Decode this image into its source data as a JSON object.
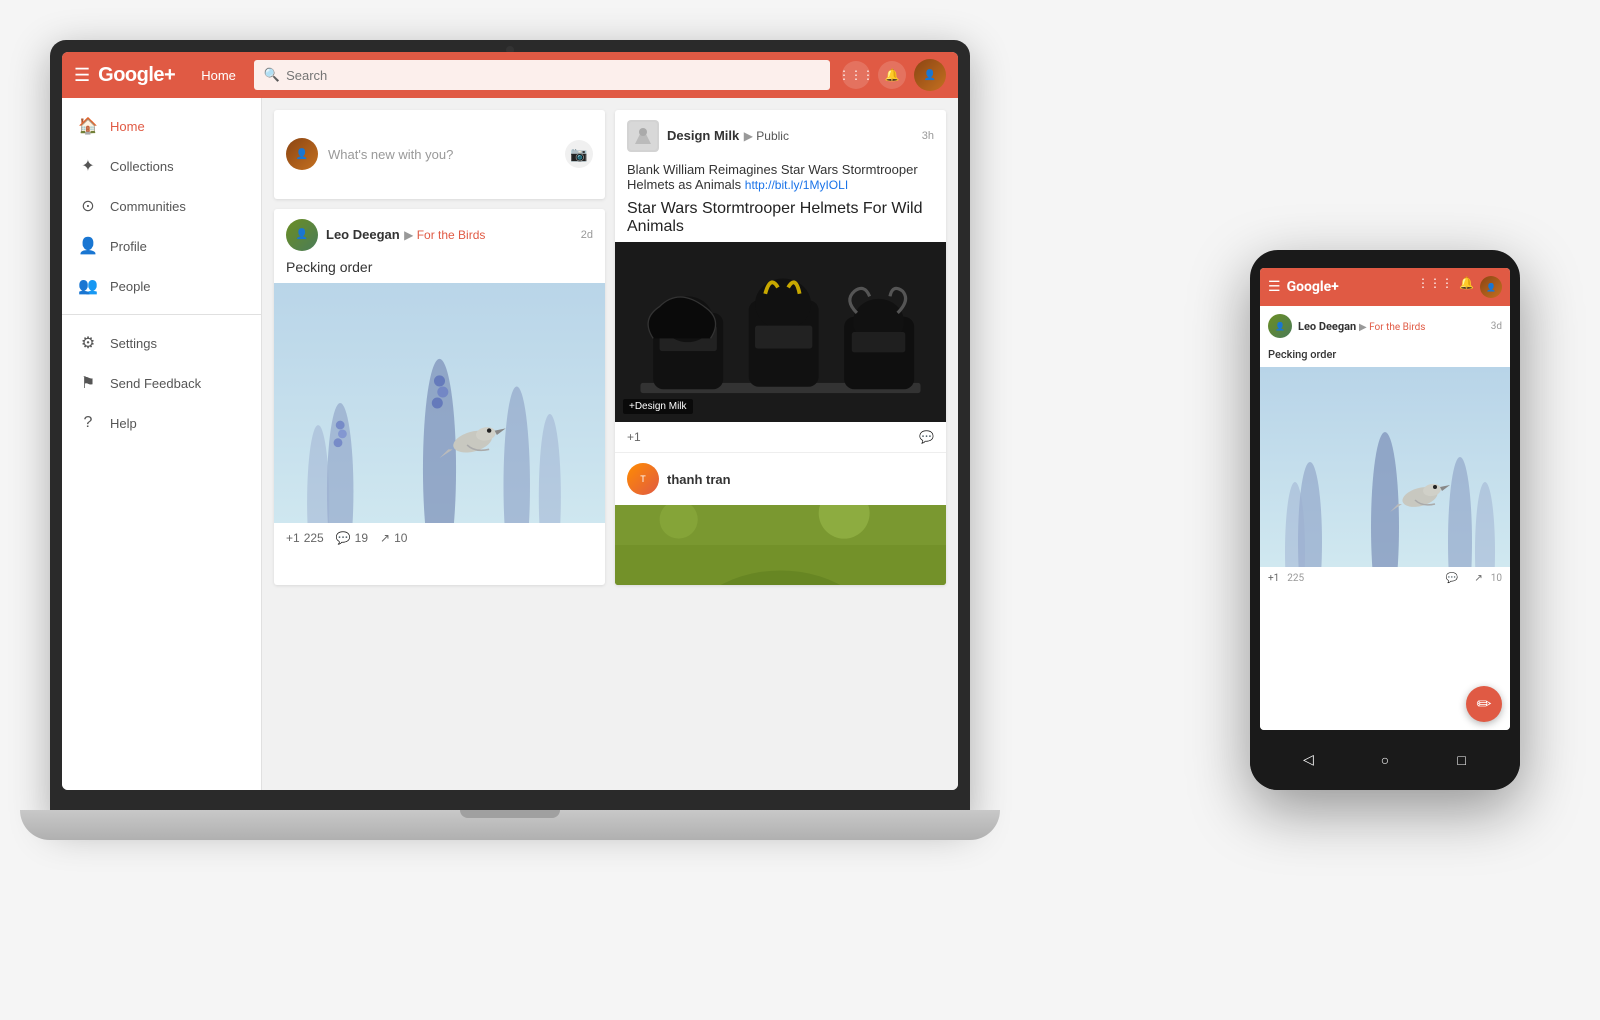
{
  "scene": {
    "bg": "#f0f0f0"
  },
  "topbar": {
    "logo": "Google+",
    "home_label": "Home",
    "search_placeholder": "Search",
    "apps_icon": "⋮⋮⋮",
    "bell_icon": "🔔"
  },
  "sidebar": {
    "items": [
      {
        "id": "home",
        "label": "Home",
        "icon": "🏠",
        "active": true
      },
      {
        "id": "collections",
        "label": "Collections",
        "icon": "✦"
      },
      {
        "id": "communities",
        "label": "Communities",
        "icon": "⊙"
      },
      {
        "id": "profile",
        "label": "Profile",
        "icon": "👤"
      },
      {
        "id": "people",
        "label": "People",
        "icon": "👥"
      }
    ],
    "secondary": [
      {
        "id": "settings",
        "label": "Settings",
        "icon": "⚙"
      },
      {
        "id": "feedback",
        "label": "Send Feedback",
        "icon": "⚑"
      },
      {
        "id": "help",
        "label": "Help",
        "icon": "?"
      }
    ]
  },
  "compose": {
    "placeholder": "What's new with you?"
  },
  "posts": [
    {
      "id": "post1",
      "author": "Leo Deegan",
      "community": "For the Birds",
      "time": "2d",
      "title": "Pecking order",
      "type": "bird"
    },
    {
      "id": "post2",
      "author": "Design Milk",
      "visibility": "Public",
      "time": "3h",
      "headline": "Blank William Reimagines Star Wars Stormtrooper Helmets as Animals",
      "link": "http://bit.ly/1MyIOLI",
      "title": "Star Wars Stormtrooper Helmets For Wild Animals",
      "label": "+Design Milk",
      "type": "stormtrooper"
    },
    {
      "id": "post3",
      "author": "thanh tran",
      "type": "green"
    }
  ],
  "actions": {
    "plus1": "+1",
    "plus1_count": "225",
    "comment_icon": "💬",
    "comment_count": "19",
    "share_icon": "↗",
    "share_count": "10"
  },
  "phone": {
    "post_author": "Leo Deegan",
    "post_community": "For the Birds",
    "post_time": "3d",
    "post_title": "Pecking order",
    "plus1_count": "225",
    "comment_count": "",
    "share_count": "10",
    "fab_icon": "✏",
    "nav": {
      "back": "◁",
      "home": "○",
      "square": "□"
    }
  }
}
